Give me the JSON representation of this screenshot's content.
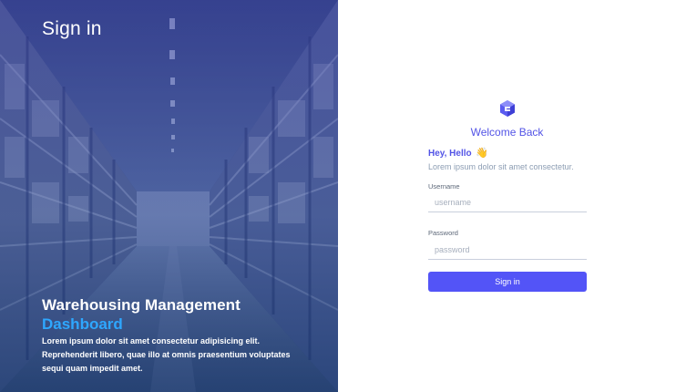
{
  "hero": {
    "title": "Sign in",
    "heading": "Warehousing Management",
    "subheading": "Dashboard",
    "description": "Lorem ipsum dolor sit amet consectetur adipisicing elit. Reprehenderit libero, quae illo at omnis praesentium voluptates sequi quam impedit amet."
  },
  "form": {
    "logo_icon": "cube-logo-icon",
    "welcome": "Welcome Back",
    "greeting": "Hey, Hello",
    "greeting_icon": "waving-hand-icon",
    "greeting_emoji": "👋",
    "subtitle": "Lorem ipsum dolor sit amet consectetur.",
    "username": {
      "label": "Username",
      "placeholder": "username",
      "value": ""
    },
    "password": {
      "label": "Password",
      "placeholder": "password",
      "value": ""
    },
    "submit_label": "Sign in"
  },
  "colors": {
    "accent": "#5354f7",
    "heading_accent": "#5354e6",
    "hero_sub": "#2ea7ff",
    "muted_text": "#8c9db3"
  }
}
